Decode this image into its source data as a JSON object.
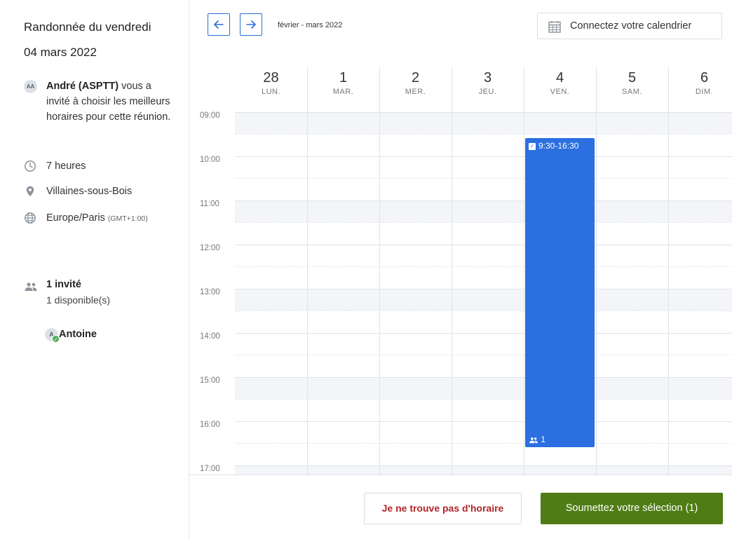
{
  "event": {
    "title": "Randonnée du vendredi",
    "date": "04 mars 2022",
    "organizer_initials": "AA",
    "organizer_name": "André (ASPTT)",
    "invite_text": "vous a invité à choisir les meilleurs horaires pour cette réunion.",
    "duration": "7 heures",
    "location": "Villaines-sous-Bois",
    "timezone": "Europe/Paris",
    "timezone_offset": "(GMT+1:00)"
  },
  "guests": {
    "count_label": "1 invité",
    "available_label": "1 disponible(s)",
    "attendees": [
      {
        "initial": "A",
        "name": "Antoine",
        "status": "available"
      }
    ]
  },
  "toolbar": {
    "prev_icon": "arrow-left-icon",
    "next_icon": "arrow-right-icon",
    "date_range": "février - mars 2022",
    "connect_label": "Connectez votre calendrier"
  },
  "calendar": {
    "days": [
      {
        "num": "28",
        "weekday": "LUN."
      },
      {
        "num": "1",
        "weekday": "MAR."
      },
      {
        "num": "2",
        "weekday": "MER."
      },
      {
        "num": "3",
        "weekday": "JEU."
      },
      {
        "num": "4",
        "weekday": "VEN."
      },
      {
        "num": "5",
        "weekday": "SAM."
      },
      {
        "num": "6",
        "weekday": "DIM."
      }
    ],
    "hours": [
      "09:00",
      "10:00",
      "11:00",
      "12:00",
      "13:00",
      "14:00",
      "15:00",
      "16:00",
      "17:00"
    ],
    "selected_slot": {
      "day": "4",
      "time_label": "9:30-16:30",
      "participants": "1"
    }
  },
  "footer": {
    "no_time_label": "Je ne trouve pas d'horaire",
    "submit_label": "Soumettez votre sélection (1)"
  },
  "colors": {
    "accent": "#2b6fe0",
    "submit": "#4f7c14",
    "danger_text": "#b0262b"
  }
}
